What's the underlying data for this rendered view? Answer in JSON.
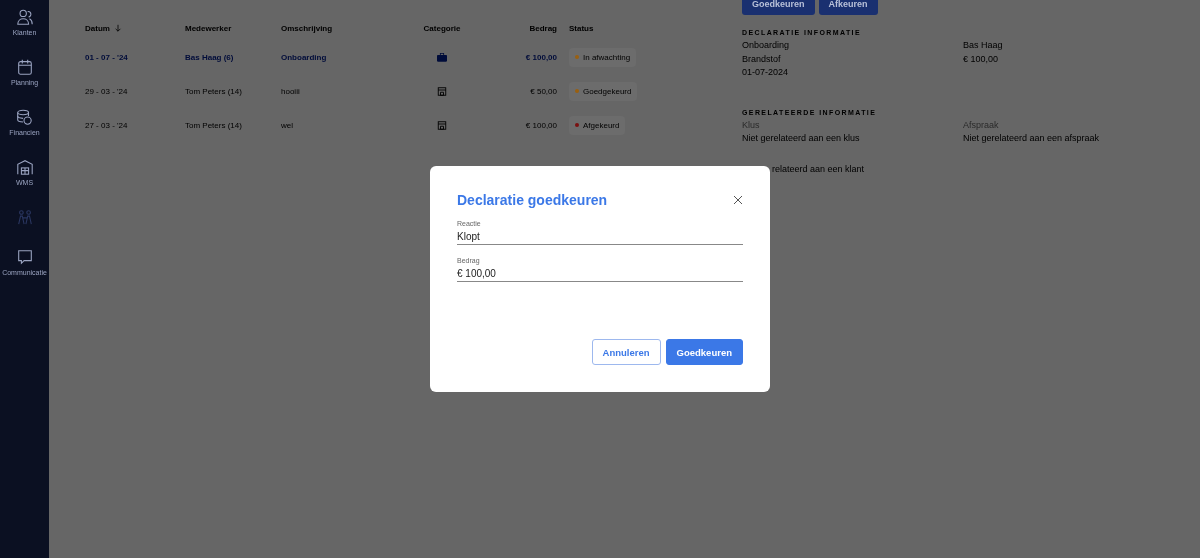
{
  "sidebar": {
    "items": [
      {
        "label": "Klanten",
        "disabled": false
      },
      {
        "label": "Planning",
        "disabled": false
      },
      {
        "label": "Financien",
        "disabled": false
      },
      {
        "label": "WMS",
        "disabled": false
      },
      {
        "disabled": true
      },
      {
        "label": "Communicatie",
        "disabled": false
      }
    ]
  },
  "table": {
    "columns": [
      "Datum",
      "Medewerker",
      "Omschrijving",
      "Categorie",
      "Bedrag",
      "Status"
    ],
    "rows": [
      {
        "selected": true,
        "date": "01 - 07 - '24",
        "employee": "Bas Haag (6)",
        "description": "Onboarding",
        "kind": "briefcase",
        "amount": "€ 100,00",
        "status": "In afwachting",
        "color": "#9a6010"
      },
      {
        "selected": false,
        "date": "29 - 03 - '24",
        "employee": "Tom Peters (14)",
        "description": "hooiii",
        "kind": "store",
        "amount": "€ 50,00",
        "status": "Goedgekeurd",
        "color": "#9a6010"
      },
      {
        "selected": false,
        "date": "27 - 03 - '24",
        "employee": "Tom Peters (14)",
        "description": "wel",
        "kind": "store",
        "amount": "€ 100,00",
        "status": "Afgekeurd",
        "color": "#7a1010"
      }
    ]
  },
  "detail": {
    "actions": [
      "Goedkeuren",
      "Afkeuren"
    ],
    "declaration_heading": "DECLARATIE INFORMATIE",
    "declaration_left": [
      "Onboarding",
      "Brandstof",
      "01-07-2024"
    ],
    "declaration_right": [
      "Bas Haag",
      "€ 100,00"
    ],
    "related_heading": "GERELATEERDE INFORMATIE",
    "related": [
      {
        "label": "Klus",
        "value": "Niet gerelateerd aan een klus"
      },
      {
        "label": "Afspraak",
        "value": "Niet gerelateerd aan een afspraak"
      }
    ],
    "related_partial": "relateerd aan een klant"
  },
  "dialog": {
    "title": "Declaratie goedkeuren",
    "fields": [
      {
        "label": "Reactie",
        "value": "Klopt"
      },
      {
        "label": "Bedrag",
        "value": "€ 100,00"
      }
    ],
    "buttons": [
      {
        "label": "Annuleren",
        "kind": "secondary"
      },
      {
        "label": "Goedkeuren",
        "kind": "primary"
      }
    ]
  }
}
